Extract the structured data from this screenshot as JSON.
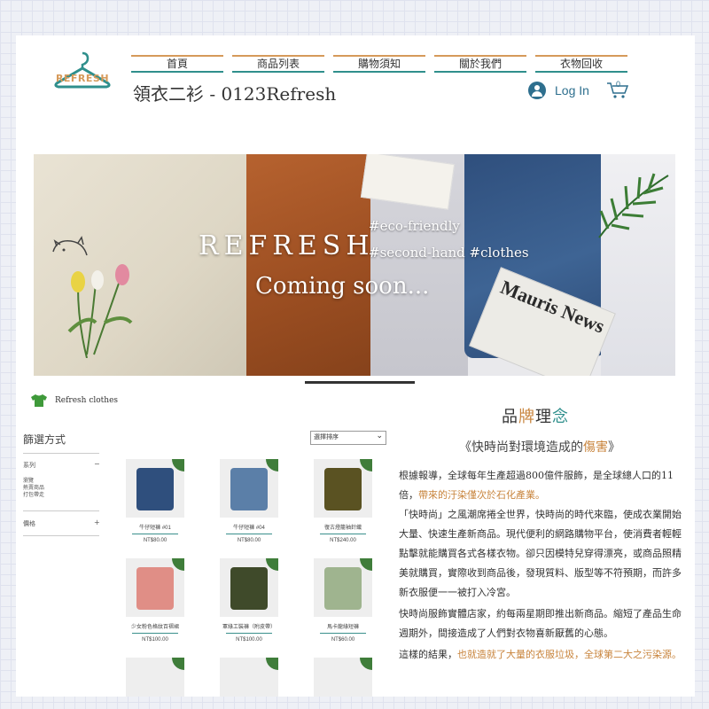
{
  "header": {
    "nav": [
      "首頁",
      "商品列表",
      "購物須知",
      "關於我們",
      "衣物回收"
    ],
    "site_title": "領衣二衫 - 0123Refresh",
    "logo_text": "REFRESH",
    "login_label": "Log In",
    "cart_count": "0"
  },
  "hero": {
    "title": "REFRESH",
    "tag1": "#eco-friendly",
    "tag2": "#second-hand #clothes",
    "subtitle": "Coming soon...",
    "newspaper": "Mauris News"
  },
  "shop": {
    "brand": "Refresh clothes",
    "filter_title": "篩選方式",
    "sort_label": "選擇排序",
    "groups": [
      {
        "label": "系列",
        "sign": "−",
        "options": [
          "瀏覽",
          "熱賣商品",
          "打包帶走"
        ]
      },
      {
        "label": "價格",
        "sign": "+",
        "options": []
      }
    ],
    "products": [
      {
        "name": "牛仔短褲 #01",
        "price": "NT$80.00",
        "color": "#2f4f7d"
      },
      {
        "name": "牛仔短褲 #04",
        "price": "NT$80.00",
        "color": "#5b7fa8"
      },
      {
        "name": "復古燈籠袖針織",
        "price": "NT$240.00",
        "color": "#5a5222"
      },
      {
        "name": "少女粉色格紋百褶裙",
        "price": "NT$100.00",
        "color": "#e08e86"
      },
      {
        "name": "軍綠工裝褲（附皮帶）",
        "price": "NT$100.00",
        "color": "#3f4a2a"
      },
      {
        "name": "馬卡龍綠短褲",
        "price": "NT$60.00",
        "color": "#9fb48f"
      }
    ]
  },
  "philosophy": {
    "title_plain1": "品",
    "title_accent1": "牌",
    "title_plain2": "理",
    "title_accent2": "念",
    "subtitle_prefix": "《快時尚對環境造成的",
    "subtitle_hl": "傷害",
    "subtitle_suffix": "》",
    "p1_line1": "根據報導，全球每年生產超過800億件服飾，是全球總人口的11",
    "p1_line2_plain": "倍，",
    "p1_line2_hl": "帶來的汙染僅次於石化產業。",
    "p2_line1": "「快時尚」之風潮席捲全世界，快時尚的時代來臨，使成衣業開始",
    "p2_line2": "大量、快速生產新商品。現代便利的網路購物平台，使消費者輕輕",
    "p2_line3": "點擊就能購買各式各樣衣物。卻只因模特兒穿得漂亮，或商品照精",
    "p2_line4": "美就購買，實際收到商品後，發現質料、版型等不符預期，而許多",
    "p2_line5": "新衣服便一一被打入冷宮。",
    "p3_line1": "快時尚服飾實體店家，約每兩星期即推出新商品。縮短了產品生命",
    "p3_line2": "週期外，間接造成了人們對衣物喜新厭舊的心態。",
    "p4_plain": "這樣的結果，",
    "p4_hl": "也就造就了大量的衣服垃圾，全球第二大之污染源。"
  },
  "colors": {
    "accent_orange": "#c8843c",
    "accent_teal": "#2f8f8c",
    "link_blue": "#2e6f8e"
  }
}
